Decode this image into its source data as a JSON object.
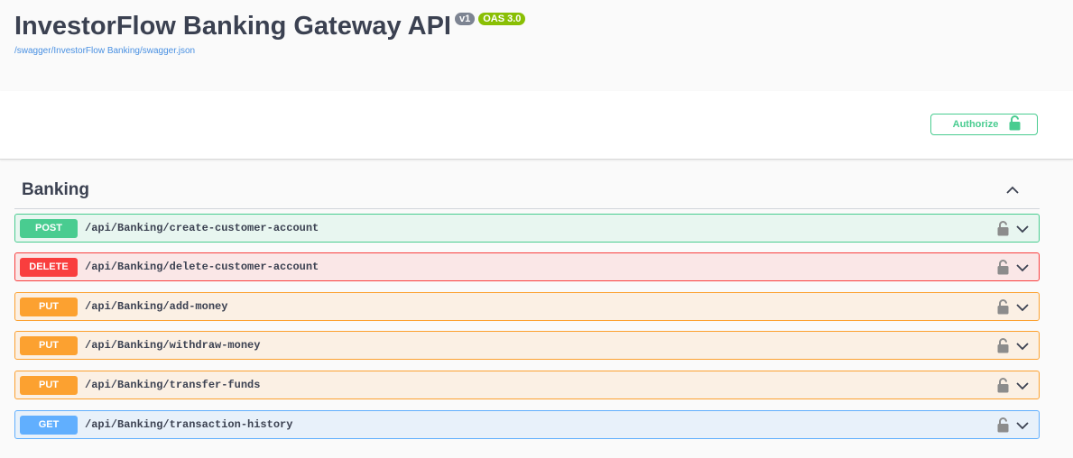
{
  "info": {
    "title": "InvestorFlow Banking Gateway API",
    "version_badge": "v1",
    "oas_badge": "OAS 3.0",
    "spec_url": "/swagger/InvestorFlow Banking/swagger.json"
  },
  "auth": {
    "authorize_label": "Authorize",
    "icon": "unlock-icon",
    "color": "#49cc90"
  },
  "tag": {
    "name": "Banking",
    "expanded": true
  },
  "operations": [
    {
      "method": "POST",
      "path": "/api/Banking/create-customer-account",
      "color": "#49cc90"
    },
    {
      "method": "DELETE",
      "path": "/api/Banking/delete-customer-account",
      "color": "#f93e3e"
    },
    {
      "method": "PUT",
      "path": "/api/Banking/add-money",
      "color": "#fca130"
    },
    {
      "method": "PUT",
      "path": "/api/Banking/withdraw-money",
      "color": "#fca130"
    },
    {
      "method": "PUT",
      "path": "/api/Banking/transfer-funds",
      "color": "#fca130"
    },
    {
      "method": "GET",
      "path": "/api/Banking/transaction-history",
      "color": "#61affe"
    }
  ]
}
